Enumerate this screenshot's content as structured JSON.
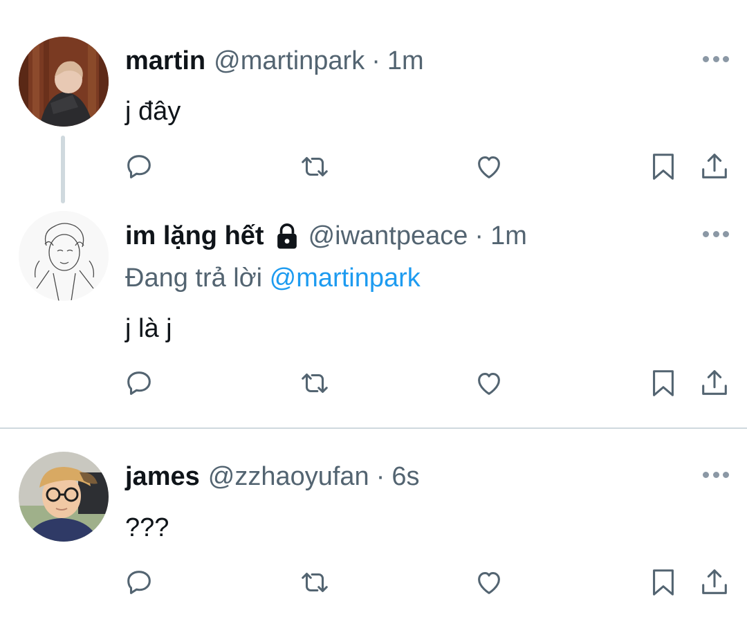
{
  "tweets": [
    {
      "name": "martin",
      "handle": "@martinpark",
      "separator": "·",
      "time": "1m",
      "text": "j đây",
      "avatar": "avatar-photo-martin"
    },
    {
      "name": "im lặng hết",
      "locked": true,
      "lock_icon": "lock-icon",
      "handle": "@iwantpeace",
      "separator": "·",
      "time": "1m",
      "reply_prefix": "Đang trả lời",
      "reply_mention": "@martinpark",
      "text": "j là j",
      "avatar": "avatar-sketch-iwantpeace"
    },
    {
      "name": "james",
      "handle": "@zzhaoyufan",
      "separator": "·",
      "time": "6s",
      "text": "???",
      "avatar": "avatar-photo-james"
    }
  ],
  "actions": [
    "reply-icon",
    "retweet-icon",
    "like-icon",
    "bookmark-icon",
    "share-icon"
  ],
  "colors": {
    "text": "#0f1419",
    "secondary": "#536471",
    "mention": "#1d9bf0",
    "divider": "#cfd9de"
  }
}
